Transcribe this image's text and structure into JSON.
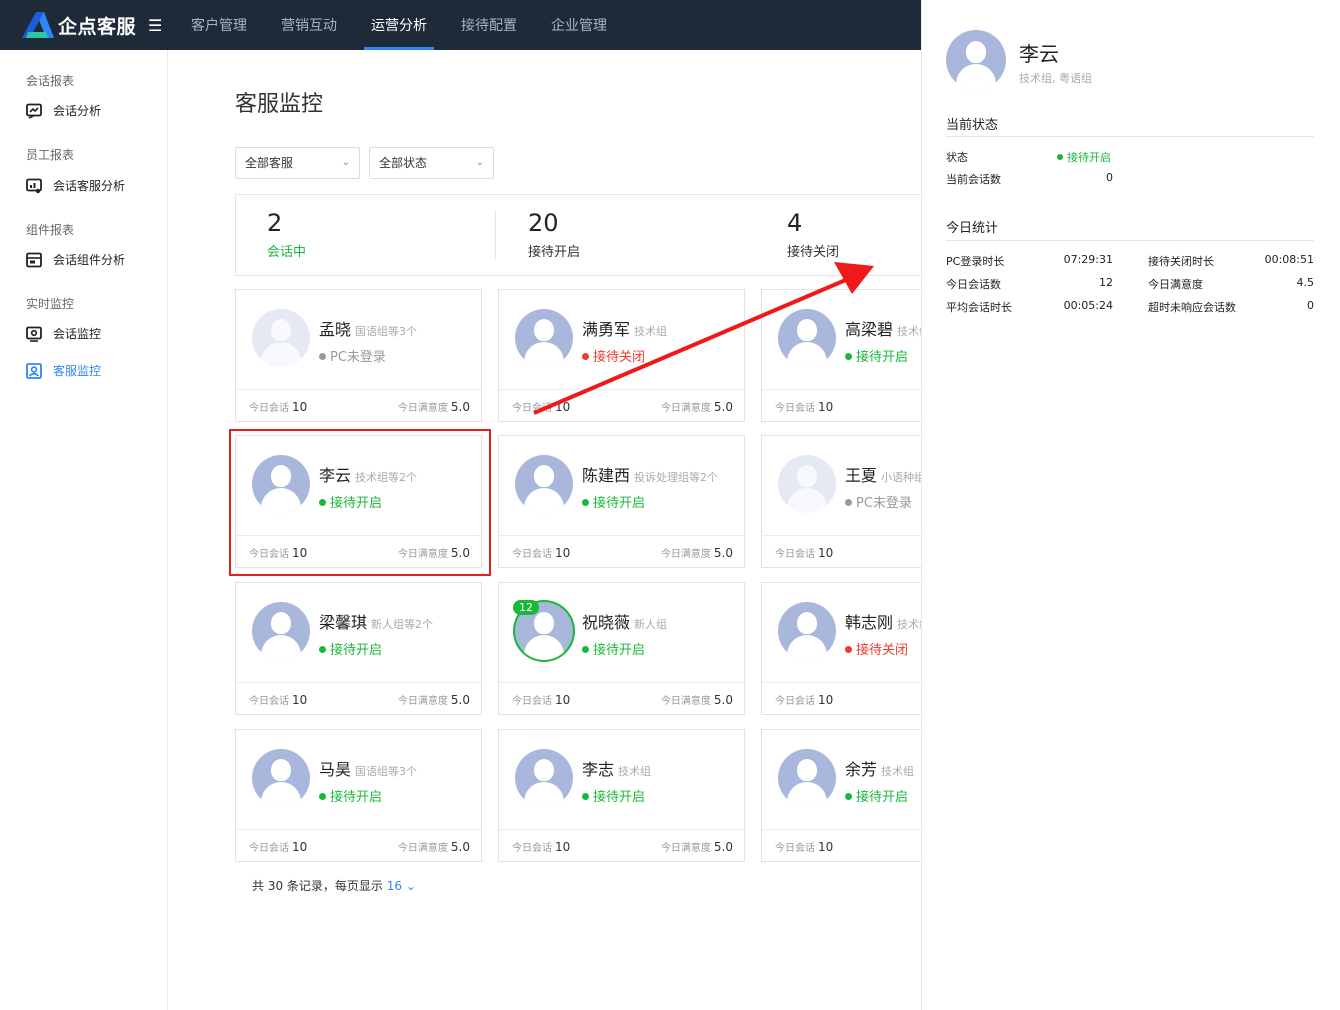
{
  "brand": {
    "name": "企点客服",
    "menu_icon": "hamburger-icon"
  },
  "nav": [
    "客户管理",
    "营销互动",
    "运营分析",
    "接待配置",
    "企业管理"
  ],
  "nav_active": "运营分析",
  "sidebar": {
    "groups": [
      {
        "title": "会话报表",
        "items": [
          {
            "label": "会话分析",
            "icon": "chart-icon"
          }
        ]
      },
      {
        "title": "员工报表",
        "items": [
          {
            "label": "会话客服分析",
            "icon": "agent-chart-icon"
          }
        ]
      },
      {
        "title": "组件报表",
        "items": [
          {
            "label": "会话组件分析",
            "icon": "widget-icon"
          }
        ]
      },
      {
        "title": "实时监控",
        "items": [
          {
            "label": "会话监控",
            "icon": "monitor-icon"
          },
          {
            "label": "客服监控",
            "icon": "agent-monitor-icon",
            "active": true
          }
        ]
      }
    ]
  },
  "page_title": "客服监控",
  "filters": {
    "agent": "全部客服",
    "status": "全部状态"
  },
  "summary": [
    {
      "value": "2",
      "label": "会话中"
    },
    {
      "value": "20",
      "label": "接待开启"
    },
    {
      "value": "4",
      "label": "接待关闭"
    }
  ],
  "card_labels": {
    "today_sessions": "今日会话",
    "today_satisfaction": "今日满意度"
  },
  "agents": [
    {
      "name": "孟晓",
      "group": "国语组等3个",
      "status": "PC未登录",
      "state": "pc",
      "sessions": "10",
      "satisfaction": "5.0",
      "avatar": "female"
    },
    {
      "name": "满勇军",
      "group": "技术组",
      "status": "接待关闭",
      "state": "off",
      "sessions": "10",
      "satisfaction": "5.0",
      "avatar": "male"
    },
    {
      "name": "高梁碧",
      "group": "技术组",
      "status": "接待开启",
      "state": "on",
      "sessions": "10",
      "satisfaction": "",
      "avatar": "female"
    },
    {
      "name": "李云",
      "group": "技术组等2个",
      "status": "接待开启",
      "state": "on",
      "sessions": "10",
      "satisfaction": "5.0",
      "avatar": "male"
    },
    {
      "name": "陈建西",
      "group": "投诉处理组等2个",
      "status": "接待开启",
      "state": "on",
      "sessions": "10",
      "satisfaction": "5.0",
      "avatar": "male"
    },
    {
      "name": "王夏",
      "group": "小语种组",
      "status": "PC未登录",
      "state": "pc",
      "sessions": "10",
      "satisfaction": "",
      "avatar": "male"
    },
    {
      "name": "梁馨琪",
      "group": "新人组等2个",
      "status": "接待开启",
      "state": "on",
      "sessions": "10",
      "satisfaction": "5.0",
      "avatar": "female"
    },
    {
      "name": "祝晓薇",
      "group": "新人组",
      "status": "接待开启",
      "state": "on",
      "sessions": "10",
      "satisfaction": "5.0",
      "avatar": "female",
      "badge": "12"
    },
    {
      "name": "韩志刚",
      "group": "技术组",
      "status": "接待关闭",
      "state": "off",
      "sessions": "10",
      "satisfaction": "",
      "avatar": "male"
    },
    {
      "name": "马昊",
      "group": "国语组等3个",
      "status": "接待开启",
      "state": "on",
      "sessions": "10",
      "satisfaction": "5.0",
      "avatar": "male"
    },
    {
      "name": "李志",
      "group": "技术组",
      "status": "接待开启",
      "state": "on",
      "sessions": "10",
      "satisfaction": "5.0",
      "avatar": "male"
    },
    {
      "name": "余芳",
      "group": "技术组",
      "status": "接待开启",
      "state": "on",
      "sessions": "10",
      "satisfaction": "",
      "avatar": "female"
    }
  ],
  "pagination": {
    "prefix": "共 30 条记录，每页显示",
    "page_size": "16"
  },
  "detail": {
    "name": "李云",
    "groups": "技术组, 粤语组",
    "current_title": "当前状态",
    "current": [
      {
        "label": "状态",
        "value": "接待开启"
      },
      {
        "label": "当前会话数",
        "value": "0"
      }
    ],
    "today_title": "今日统计",
    "today": [
      {
        "label": "PC登录时长",
        "value": "07:29:31",
        "label2": "接待关闭时长",
        "value2": "00:08:51"
      },
      {
        "label": "今日会话数",
        "value": "12",
        "label2": "今日满意度",
        "value2": "4.5"
      },
      {
        "label": "平均会话时长",
        "value": "00:05:24",
        "label2": "超时未响应会话数",
        "value2": "0"
      }
    ]
  },
  "colors": {
    "nav_bg": "#1f2a38",
    "accent": "#2f86f6",
    "online": "#1ab83a",
    "offline": "#f03a2e",
    "highlight": "#e02020"
  }
}
